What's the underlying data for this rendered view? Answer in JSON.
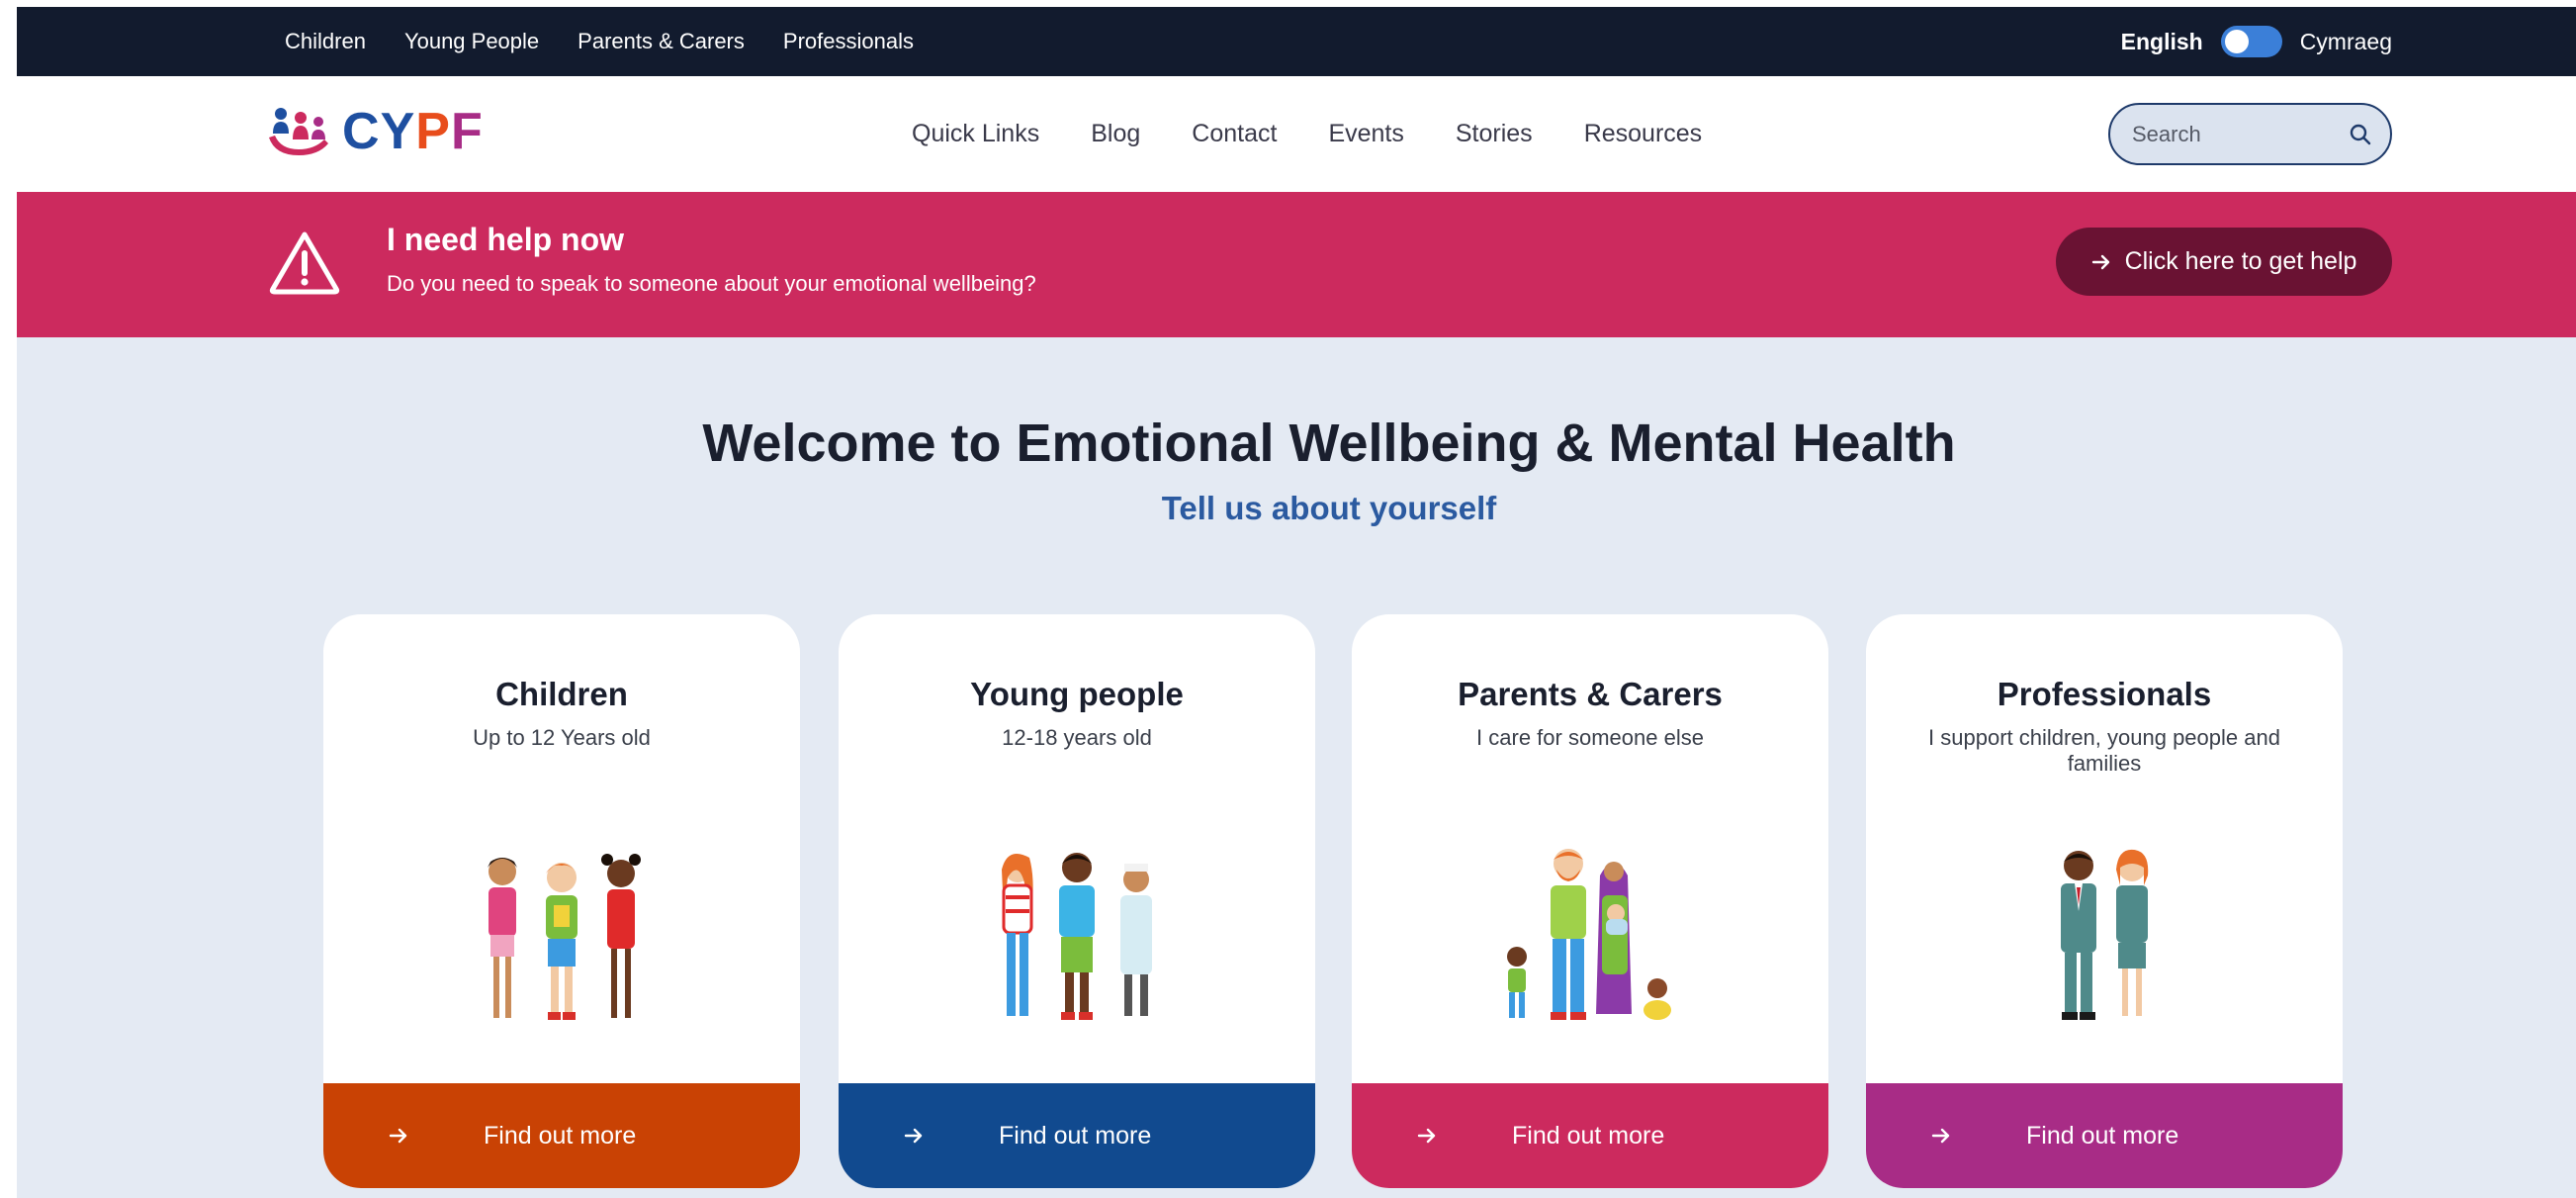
{
  "topbar": {
    "links": [
      "Children",
      "Young People",
      "Parents & Carers",
      "Professionals"
    ],
    "lang_active": "English",
    "lang_other": "Cymraeg"
  },
  "header": {
    "logo_text": {
      "c": "C",
      "y": "Y",
      "p": "P",
      "f": "F"
    },
    "nav": [
      "Quick Links",
      "Blog",
      "Contact",
      "Events",
      "Stories",
      "Resources"
    ],
    "search_placeholder": "Search"
  },
  "help": {
    "title": "I need help now",
    "subtitle": "Do you need to speak to someone about your emotional wellbeing?",
    "button": "Click here to get help"
  },
  "welcome": {
    "title": "Welcome to Emotional Wellbeing & Mental Health",
    "subtitle": "Tell us about yourself"
  },
  "cards": [
    {
      "title": "Children",
      "desc": "Up to 12 Years old",
      "button": "Find out more",
      "color": "#c94204"
    },
    {
      "title": "Young people",
      "desc": "12-18 years old",
      "button": "Find out more",
      "color": "#114a8f"
    },
    {
      "title": "Parents & Carers",
      "desc": "I care for someone else",
      "button": "Find out more",
      "color": "#cc2a5e"
    },
    {
      "title": "Professionals",
      "desc": "I support children, young people and families",
      "button": "Find out more",
      "color": "#a82c86"
    }
  ],
  "colors": {
    "topbar": "#121b2e",
    "help_banner": "#cc2a5e",
    "help_button": "#6a1233",
    "page_bg": "#e4eaf3",
    "logo_c": "#1e4fa0",
    "logo_y": "#1e4fa0",
    "logo_p": "#e84d1c",
    "logo_f": "#a82c86"
  },
  "icons": {
    "warning": "warning-triangle-icon",
    "search": "search-icon",
    "arrow": "arrow-right-icon"
  }
}
